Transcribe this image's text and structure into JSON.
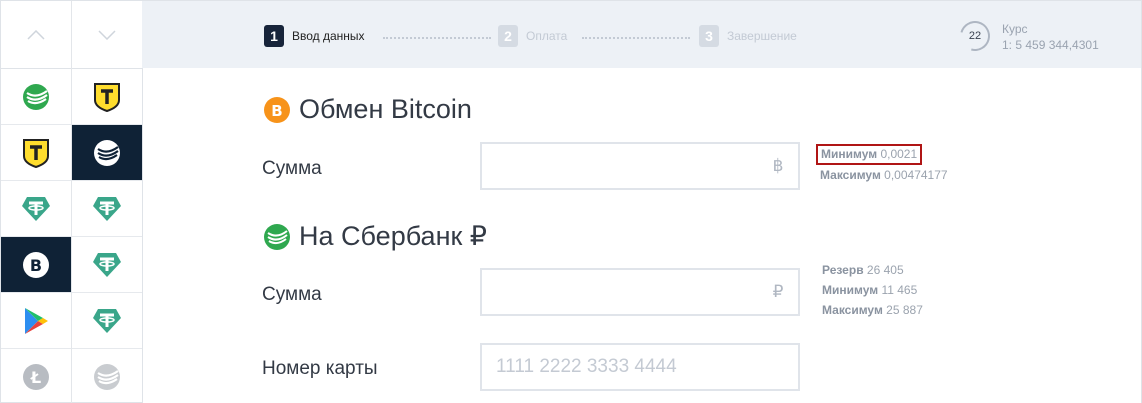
{
  "sidebar": {
    "col1": [
      {
        "icon": "sberbank-icon",
        "active": false
      },
      {
        "icon": "tinkoff-icon",
        "active": false
      },
      {
        "icon": "tether-icon",
        "active": false
      },
      {
        "icon": "bitcoin-icon",
        "active": true
      },
      {
        "icon": "google-play-icon",
        "active": false
      },
      {
        "icon": "litecoin-icon",
        "active": false
      }
    ],
    "col2": [
      {
        "icon": "tinkoff-icon",
        "active": false
      },
      {
        "icon": "sberbank-icon",
        "active": true
      },
      {
        "icon": "tether-icon",
        "active": false
      },
      {
        "icon": "tether-icon",
        "active": false
      },
      {
        "icon": "tether-icon",
        "active": false
      },
      {
        "icon": "sberbank-icon",
        "active": false
      }
    ]
  },
  "steps": [
    {
      "num": "1",
      "label": "Ввод данных",
      "active": true
    },
    {
      "num": "2",
      "label": "Оплата",
      "active": false
    },
    {
      "num": "3",
      "label": "Завершение",
      "active": false
    }
  ],
  "rate": {
    "timer": "22",
    "label": "Курс",
    "value": "1: 5 459 344,4301"
  },
  "give": {
    "title": "Обмен Bitcoin",
    "amount_label": "Сумма",
    "currency": "฿",
    "min_label": "Минимум",
    "min_value": "0,0021",
    "max_label": "Максимум",
    "max_value": "0,00474177"
  },
  "get": {
    "title": "На Сбербанк ₽",
    "amount_label": "Сумма",
    "currency": "₽",
    "reserve_label": "Резерв",
    "reserve_value": "26 405",
    "min_label": "Минимум",
    "min_value": "11 465",
    "max_label": "Максимум",
    "max_value": "25 887",
    "card_label": "Номер карты",
    "card_placeholder": "1111 2222 3333 4444"
  },
  "colors": {
    "sber": "#2fa84f",
    "tinkoff": "#ffdd2d",
    "tether": "#3aa68a",
    "bitcoin": "#f7931a",
    "dark": "#0f2236",
    "highlight": "#b01515"
  }
}
